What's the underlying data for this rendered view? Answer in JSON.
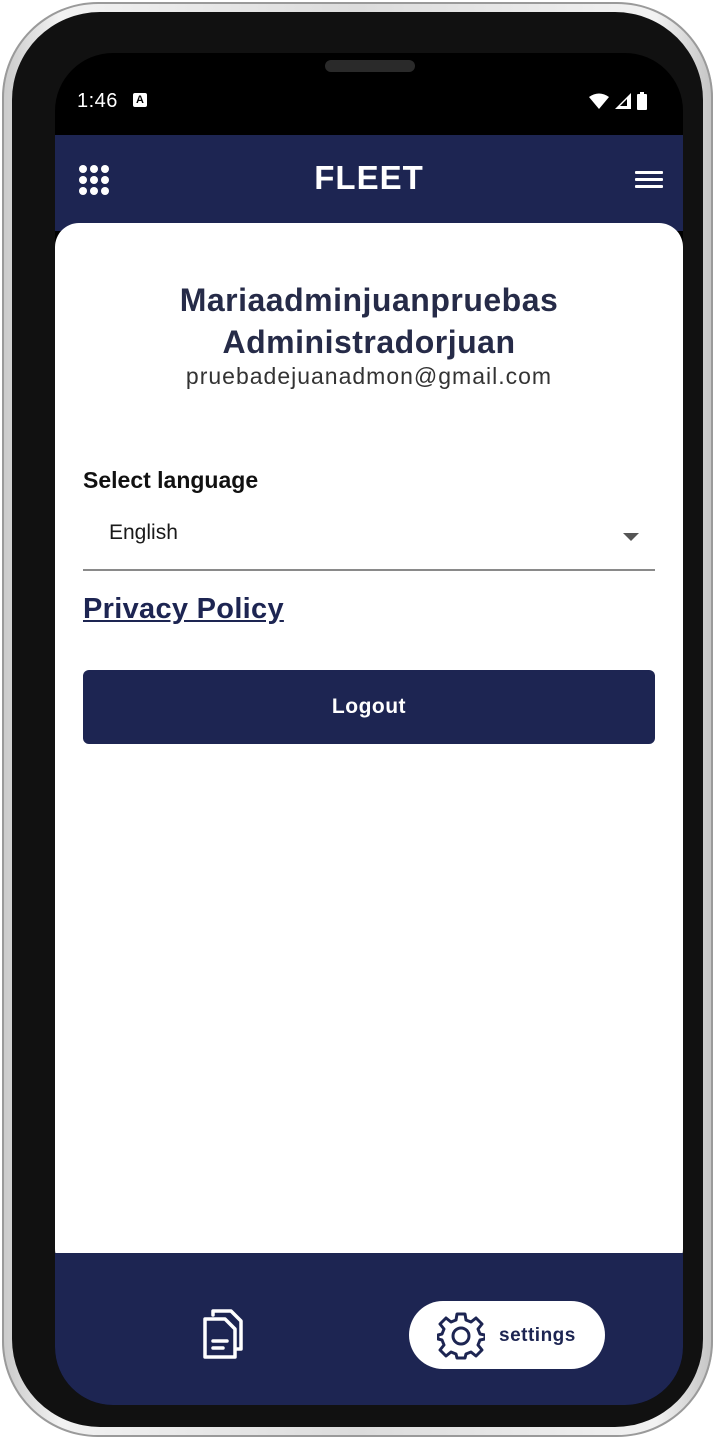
{
  "status_bar": {
    "time": "1:46",
    "notification_icon": "a-notification-icon",
    "icons": [
      "wifi-icon",
      "signal-icon",
      "battery-icon"
    ]
  },
  "app_bar": {
    "title": "FLEET",
    "left_icon": "apps-grid-icon",
    "right_icon": "hamburger-menu-icon"
  },
  "profile": {
    "name_line1": "Mariaadminjuanpruebas",
    "name_line2": "Administradorjuan",
    "email": "pruebadejuanadmon@gmail.com"
  },
  "language": {
    "label": "Select language",
    "selected": "English"
  },
  "privacy_link": "Privacy Policy",
  "logout_label": "Logout",
  "bottom_nav": {
    "items": [
      {
        "icon": "documents-icon",
        "label": ""
      },
      {
        "icon": "gear-icon",
        "label": "settings",
        "active": true
      }
    ]
  },
  "colors": {
    "primary": "#1d2552",
    "text_dark": "#262b48",
    "background": "#ffffff"
  }
}
